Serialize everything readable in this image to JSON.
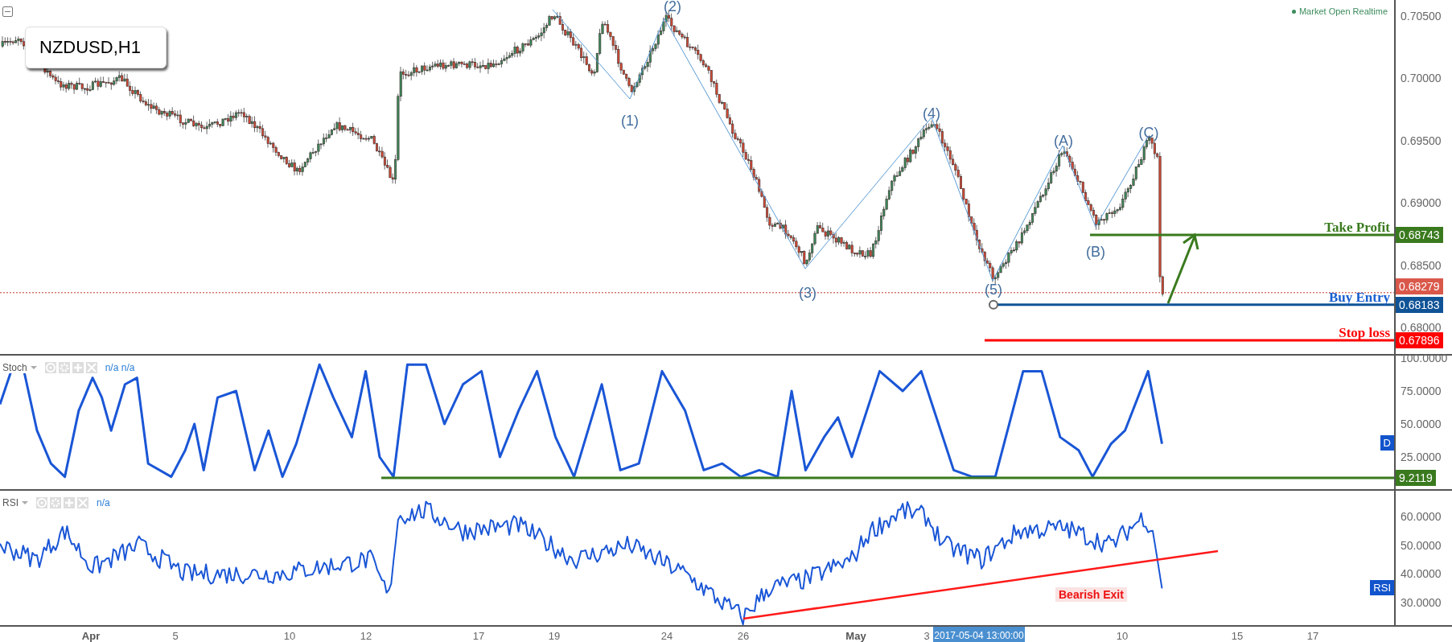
{
  "chart": {
    "symbol": "NZDUSD,H1",
    "status": "Market Open Realtime",
    "price_ticks": [
      "0.70500",
      "0.70000",
      "0.69500",
      "0.69000",
      "0.68500",
      "0.68000"
    ],
    "wave_labels": [
      "(1)",
      "(2)",
      "(3)",
      "(4)",
      "(5)",
      "(A)",
      "(B)",
      "(C)"
    ],
    "last_price": "0.68279",
    "levels": [
      {
        "kind": "take_profit",
        "label": "Take Profit",
        "price": "0.68743",
        "color": "#3a7a1e"
      },
      {
        "kind": "buy_entry",
        "label": "Buy Entry",
        "price": "0.68183",
        "color": "#0f5396"
      },
      {
        "kind": "stop_loss",
        "label": "Stop loss",
        "price": "0.67896",
        "color": "#ff0000"
      }
    ]
  },
  "stochastic": {
    "name": "Stoch",
    "values_text": "n/a n/a",
    "ticks": [
      "100.0000",
      "75.0000",
      "50.0000",
      "25.0000"
    ],
    "level": "9.2119",
    "badge": "D"
  },
  "rsi": {
    "name": "RSI",
    "values_text": "n/a",
    "ticks": [
      "60.0000",
      "50.0000",
      "40.0000",
      "30.0000"
    ],
    "badge": "RSI",
    "annotation": "Bearish Exit"
  },
  "time_axis": {
    "labels": [
      {
        "text": "Apr",
        "kind": "month"
      },
      {
        "text": "5",
        "kind": "day"
      },
      {
        "text": "10",
        "kind": "day"
      },
      {
        "text": "12",
        "kind": "day"
      },
      {
        "text": "17",
        "kind": "day"
      },
      {
        "text": "19",
        "kind": "day"
      },
      {
        "text": "24",
        "kind": "day"
      },
      {
        "text": "26",
        "kind": "day"
      },
      {
        "text": "May",
        "kind": "month"
      },
      {
        "text": "3",
        "kind": "day"
      },
      {
        "text": "10",
        "kind": "day"
      },
      {
        "text": "15",
        "kind": "day"
      },
      {
        "text": "17",
        "kind": "day"
      }
    ],
    "crosshair": "2017-05-04 13:00:00"
  }
}
